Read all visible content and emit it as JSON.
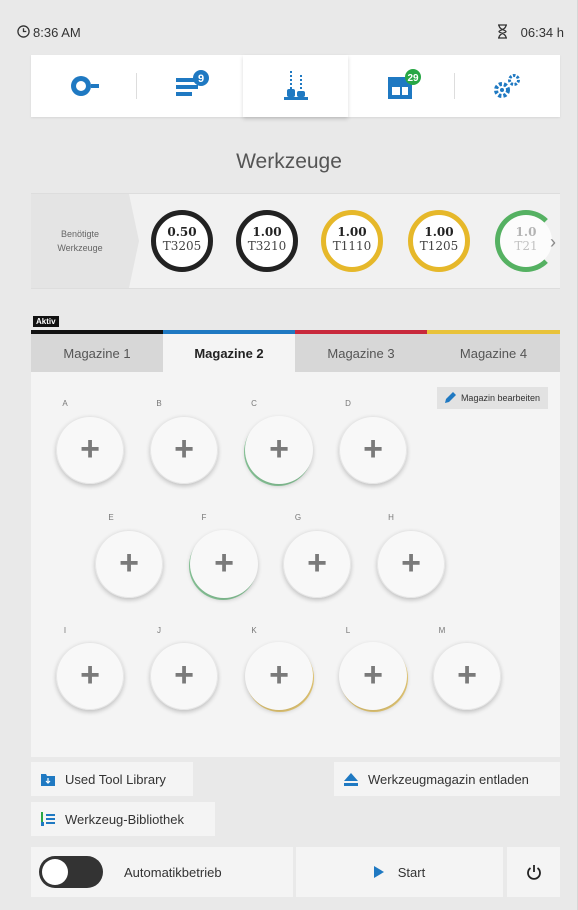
{
  "status": {
    "time": "8:36 AM",
    "timer": "06:34 h"
  },
  "nav": {
    "items": [
      {
        "name": "machine",
        "icon": "machine-status-icon"
      },
      {
        "name": "jobs",
        "icon": "job-list-icon",
        "badge": "9",
        "badge_color": "#1f79c2"
      },
      {
        "name": "tools",
        "icon": "tools-icon",
        "active": true
      },
      {
        "name": "materials",
        "icon": "material-icon",
        "badge": "29",
        "badge_color": "#28a745"
      },
      {
        "name": "settings",
        "icon": "gears-icon"
      }
    ]
  },
  "page_title": "Werkzeuge",
  "required_tools": {
    "label_line1": "Benötigte",
    "label_line2": "Werkzeuge",
    "tools": [
      {
        "value": "0.50",
        "id": "T3205",
        "color": "#222222"
      },
      {
        "value": "1.00",
        "id": "T3210",
        "color": "#222222"
      },
      {
        "value": "1.00",
        "id": "T1110",
        "color": "#e6b82a"
      },
      {
        "value": "1.00",
        "id": "T1205",
        "color": "#e6b82a"
      },
      {
        "value": "1.0",
        "id": "T21",
        "color": "#3aa64a"
      }
    ]
  },
  "active_label": "Aktiv",
  "tabs": [
    {
      "label": "Magazine 1",
      "color": "#111111"
    },
    {
      "label": "Magazine 2",
      "color": "#1f79c2",
      "active": true
    },
    {
      "label": "Magazine 3",
      "color": "#c8283b"
    },
    {
      "label": "Magazine 4",
      "color": "#e8c23a"
    }
  ],
  "edit_magazine": "Magazin bearbeiten",
  "slots": [
    "A",
    "B",
    "C",
    "D",
    "E",
    "F",
    "G",
    "H",
    "I",
    "J",
    "K",
    "L",
    "M"
  ],
  "used_tool_library": "Used Tool Library",
  "unload_magazine": "Werkzeugmagazin entladen",
  "tool_library": "Werkzeug-Bibliothek",
  "automatic_mode": "Automatikbetrieb",
  "start": "Start",
  "colors": {
    "accent": "#1f79c2",
    "green": "#28a745"
  }
}
